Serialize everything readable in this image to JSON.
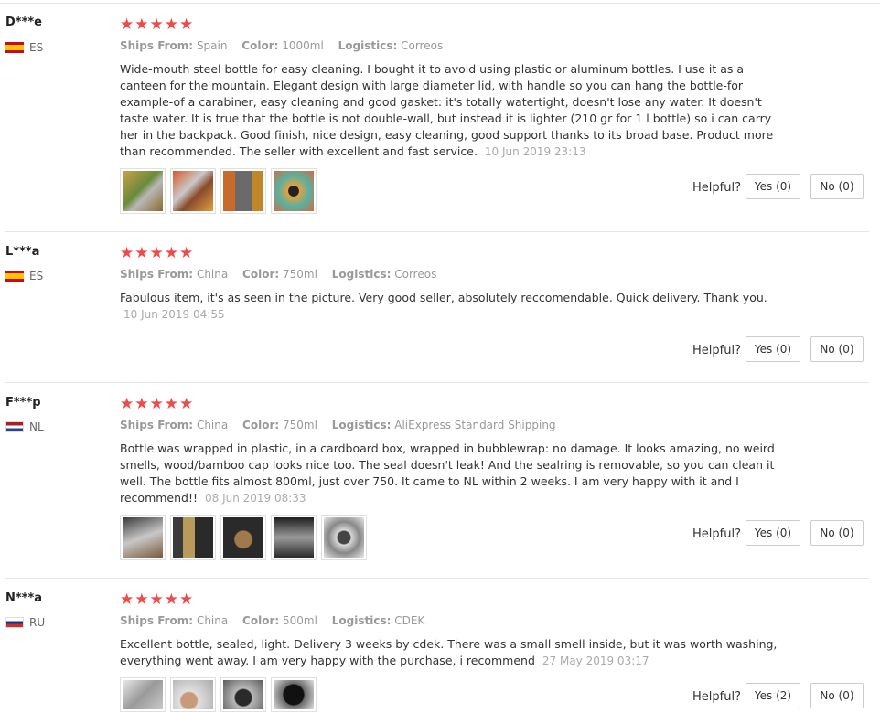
{
  "labels": {
    "ships_from": "Ships From:",
    "color": "Color:",
    "logistics": "Logistics:",
    "helpful": "Helpful?"
  },
  "colors": {
    "star": "#f04a4a",
    "muted": "#999999"
  },
  "reviews": [
    {
      "user": "D***e",
      "country_code": "ES",
      "rating": 5,
      "stars": "★★★★★",
      "ships_from": "Spain",
      "color": "1000ml",
      "logistics": "Correos",
      "text": "Wide-mouth steel bottle for easy cleaning. I bought it to avoid using plastic or aluminum bottles. I use it as a canteen for the mountain. Elegant design with large diameter lid, with handle so you can hang the bottle-for example-of a carabiner, easy cleaning and good gasket: it's totally watertight, doesn't lose any water. It doesn't taste water. It is true that the bottle is not double-wall, but instead it is lighter (210 gr for 1 l bottle) so i can carry her in the backpack. Good finish, nice design, easy cleaning, good support thanks to its broad base. Product more than recommended. The seller with excellent and fast service.",
      "date": "10 Jun 2019 23:13",
      "yes": "Yes (0)",
      "no": "No (0)"
    },
    {
      "user": "L***a",
      "country_code": "ES",
      "rating": 5,
      "stars": "★★★★★",
      "ships_from": "China",
      "color": "750ml",
      "logistics": "Correos",
      "text": "Fabulous item, it's as seen in the picture. Very good seller, absolutely reccomendable. Quick delivery. Thank you.",
      "date": "10 Jun 2019 04:55",
      "yes": "Yes (0)",
      "no": "No (0)"
    },
    {
      "user": "F***p",
      "country_code": "NL",
      "rating": 5,
      "stars": "★★★★★",
      "ships_from": "China",
      "color": "750ml",
      "logistics": "AliExpress Standard Shipping",
      "text": "Bottle was wrapped in plastic, in a cardboard box, wrapped in bubblewrap: no damage. It looks amazing, no weird smells, wood/bamboo cap looks nice too. The seal doesn't leak! And the sealring is removable, so you can clean it well. The bottle fits almost 800ml, just over 750. It came to NL within 2 weeks. I am very happy with it and I recommend!!",
      "date": "08 Jun 2019 08:33",
      "yes": "Yes (0)",
      "no": "No (0)"
    },
    {
      "user": "N***a",
      "country_code": "RU",
      "rating": 5,
      "stars": "★★★★★",
      "ships_from": "China",
      "color": "500ml",
      "logistics": "CDEK",
      "text": "Excellent bottle, sealed, light. Delivery 3 weeks by cdek. There was a small smell inside, but it was worth washing, everything went away. I am very happy with the purchase, i recommend",
      "date": "27 May 2019 03:17",
      "yes": "Yes (2)",
      "no": "No (0)"
    }
  ]
}
